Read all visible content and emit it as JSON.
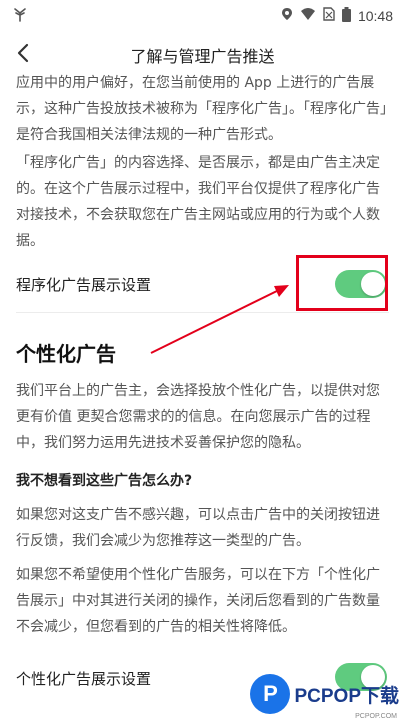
{
  "status_bar": {
    "time": "10:48",
    "icons": [
      "plant-icon",
      "location-icon",
      "wifi-icon",
      "no-sim-icon",
      "battery-icon"
    ]
  },
  "header": {
    "title": "了解与管理广告推送",
    "back_icon": "chevron-left-icon"
  },
  "intro": {
    "p1": "应用中的用户偏好，在您当前使用的 App 上进行的广告展示，这种广告投放技术被称为「程序化广告」。「程序化广告」是符合我国相关法律法规的一种广告形式。",
    "p2": "「程序化广告」的内容选择、是否展示，都是由广告主决定的。在这个广告展示过程中，我们平台仅提供了程序化广告对接技术，不会获取您在广告主网站或应用的行为或个人数据。"
  },
  "programmatic_setting": {
    "label": "程序化广告展示设置",
    "enabled": true
  },
  "personalized": {
    "title": "个性化广告",
    "p1": "我们平台上的广告主，会选择投放个性化广告，以提供对您更有价值 更契合您需求的的信息。在向您展示广告的过程中，我们努力运用先进技术妥善保护您的隐私。",
    "question": "我不想看到这些广告怎么办?",
    "p2": "如果您对这支广告不感兴趣，可以点击广告中的关闭按钮进行反馈，我们会减少为您推荐这一类型的广告。",
    "p3": "如果您不希望使用个性化广告服务，可以在下方「个性化广告展示」中对其进行关闭的操作，关闭后您看到的广告数量不会减少，但您看到的广告的相关性将降低。"
  },
  "personalized_setting": {
    "label": "个性化广告展示设置",
    "enabled": true
  },
  "annotation": {
    "highlight_color": "#e3001b"
  },
  "watermark": {
    "logo_letter": "P",
    "text": "PCPOP下载",
    "sub": "PCPOP.COM"
  },
  "colors": {
    "toggle_on": "#5fcb7f",
    "text": "#555555"
  }
}
